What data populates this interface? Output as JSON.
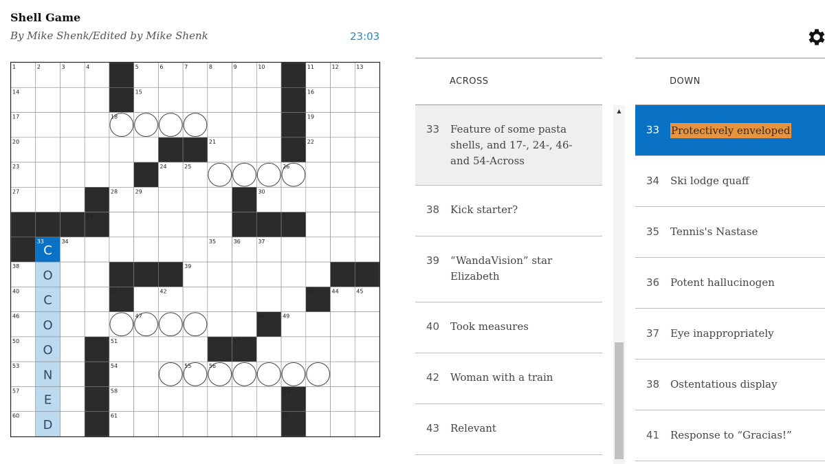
{
  "puzzle": {
    "title": "Shell Game",
    "byline": "By Mike Shenk/Edited by Mike Shenk",
    "timer": "23:03"
  },
  "toolbar": {
    "settings_icon": "gear-icon"
  },
  "colors": {
    "highlight": "#0a72c4",
    "cross": "#bcd9ee",
    "selected_text": "#e8943e",
    "block": "#2b2b2b"
  },
  "grid": {
    "size": 15,
    "rows": [
      "....#......#...",
      "....#......#...",
      "...........#...",
      "......##...#...",
      ".....#.........",
      "...#.....#.....",
      "####.....###...",
      "#..............",
      "....###......##",
      "....#.......#..",
      "..........#....",
      "...#....##.....",
      "...#...........",
      "...#.......#...",
      "...#.......#..."
    ],
    "numbers": [
      [
        0,
        0,
        1
      ],
      [
        0,
        1,
        2
      ],
      [
        0,
        2,
        3
      ],
      [
        0,
        3,
        4
      ],
      [
        0,
        5,
        5
      ],
      [
        0,
        6,
        6
      ],
      [
        0,
        7,
        7
      ],
      [
        0,
        8,
        8
      ],
      [
        0,
        9,
        9
      ],
      [
        0,
        10,
        10
      ],
      [
        0,
        12,
        11
      ],
      [
        0,
        13,
        12
      ],
      [
        0,
        14,
        13
      ],
      [
        1,
        0,
        14
      ],
      [
        1,
        5,
        15
      ],
      [
        1,
        12,
        16
      ],
      [
        2,
        0,
        17
      ],
      [
        2,
        4,
        18
      ],
      [
        2,
        12,
        19
      ],
      [
        3,
        0,
        20
      ],
      [
        3,
        8,
        21
      ],
      [
        3,
        12,
        22
      ],
      [
        4,
        0,
        23
      ],
      [
        4,
        6,
        24
      ],
      [
        4,
        7,
        25
      ],
      [
        4,
        11,
        26
      ],
      [
        5,
        0,
        27
      ],
      [
        5,
        4,
        28
      ],
      [
        5,
        5,
        29
      ],
      [
        5,
        10,
        30
      ],
      [
        6,
        3,
        31
      ],
      [
        6,
        11,
        32
      ],
      [
        7,
        1,
        33
      ],
      [
        7,
        2,
        34
      ],
      [
        7,
        8,
        35
      ],
      [
        7,
        9,
        36
      ],
      [
        7,
        10,
        37
      ],
      [
        8,
        0,
        38
      ],
      [
        8,
        7,
        39
      ],
      [
        9,
        0,
        40
      ],
      [
        9,
        4,
        41
      ],
      [
        9,
        6,
        42
      ],
      [
        9,
        12,
        43
      ],
      [
        9,
        13,
        44
      ],
      [
        9,
        14,
        45
      ],
      [
        10,
        0,
        46
      ],
      [
        10,
        5,
        47
      ],
      [
        10,
        10,
        48
      ],
      [
        10,
        11,
        49
      ],
      [
        11,
        0,
        50
      ],
      [
        11,
        4,
        51
      ],
      [
        11,
        9,
        52
      ],
      [
        12,
        0,
        53
      ],
      [
        12,
        4,
        54
      ],
      [
        12,
        7,
        55
      ],
      [
        12,
        8,
        56
      ],
      [
        13,
        0,
        57
      ],
      [
        13,
        4,
        58
      ],
      [
        13,
        11,
        59
      ],
      [
        14,
        0,
        60
      ],
      [
        14,
        4,
        61
      ],
      [
        14,
        11,
        62
      ]
    ],
    "circles": [
      [
        2,
        4
      ],
      [
        2,
        5
      ],
      [
        2,
        6
      ],
      [
        2,
        7
      ],
      [
        4,
        8
      ],
      [
        4,
        9
      ],
      [
        4,
        10
      ],
      [
        4,
        11
      ],
      [
        10,
        4
      ],
      [
        10,
        5
      ],
      [
        10,
        6
      ],
      [
        10,
        7
      ],
      [
        12,
        6
      ],
      [
        12,
        7
      ],
      [
        12,
        8
      ],
      [
        12,
        9
      ],
      [
        12,
        10
      ],
      [
        12,
        11
      ],
      [
        12,
        12
      ]
    ],
    "entries": [
      [
        7,
        1,
        "C"
      ],
      [
        8,
        1,
        "O"
      ],
      [
        9,
        1,
        "C"
      ],
      [
        10,
        1,
        "O"
      ],
      [
        11,
        1,
        "O"
      ],
      [
        12,
        1,
        "N"
      ],
      [
        13,
        1,
        "E"
      ],
      [
        14,
        1,
        "D"
      ]
    ],
    "active_cell": [
      7,
      1
    ],
    "highlight_col": 1,
    "highlight_rows": [
      7,
      14
    ]
  },
  "across": {
    "heading": "ACROSS",
    "clues": [
      {
        "num": "33",
        "text": "Feature of some pasta shells, and 17-, 24-, 46- and 54-Across"
      },
      {
        "num": "38",
        "text": "Kick starter?"
      },
      {
        "num": "39",
        "text": "“WandaVision” star Elizabeth"
      },
      {
        "num": "40",
        "text": "Took measures"
      },
      {
        "num": "42",
        "text": "Woman with a train"
      },
      {
        "num": "43",
        "text": "Relevant"
      }
    ]
  },
  "down": {
    "heading": "DOWN",
    "clues": [
      {
        "num": "33",
        "text": "Protectively enveloped"
      },
      {
        "num": "34",
        "text": "Ski lodge quaff"
      },
      {
        "num": "35",
        "text": "Tennis's Nastase"
      },
      {
        "num": "36",
        "text": "Potent hallucinogen"
      },
      {
        "num": "37",
        "text": "Eye inappropriately"
      },
      {
        "num": "38",
        "text": "Ostentatious display"
      },
      {
        "num": "41",
        "text": "Response to “Gracias!”"
      }
    ]
  }
}
